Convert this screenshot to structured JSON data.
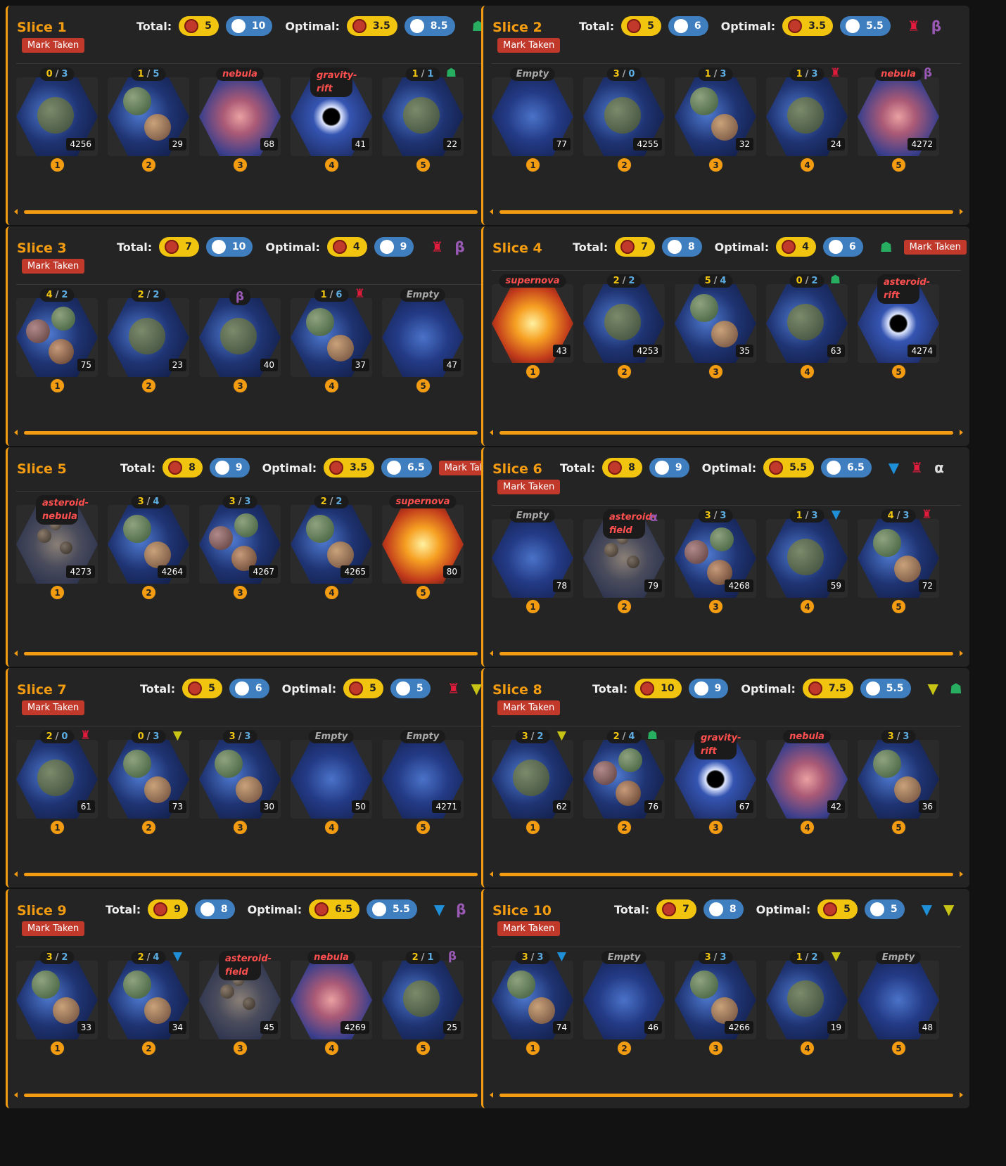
{
  "labels": {
    "total": "Total:",
    "optimal": "Optimal:",
    "mark_taken": "Mark Taken"
  },
  "icons": {
    "hacan": {
      "glyph": "☗",
      "name": "green-faction-icon"
    },
    "red": {
      "glyph": "♜",
      "name": "red-faction-icon"
    },
    "beta": {
      "glyph": "β",
      "name": "beta-wormhole-icon"
    },
    "alpha": {
      "glyph": "α",
      "name": "alpha-wormhole-icon"
    },
    "blue": {
      "glyph": "▼",
      "name": "blue-tech-skip-icon"
    },
    "yellow": {
      "glyph": "▼",
      "name": "yellow-tech-skip-icon"
    }
  },
  "slices": [
    {
      "name": "Slice 1",
      "mark_inline": false,
      "total": {
        "res": "5",
        "inf": "10"
      },
      "optimal": {
        "res": "3.5",
        "inf": "8.5"
      },
      "tags": [
        "hacan"
      ],
      "tiles": [
        {
          "label_type": "ratio",
          "r": "0",
          "i": "3",
          "icon": "",
          "id": "4256",
          "pos": "1",
          "bg": "planet1"
        },
        {
          "label_type": "ratio",
          "r": "1",
          "i": "5",
          "icon": "",
          "id": "29",
          "pos": "2",
          "bg": "planet2"
        },
        {
          "label_type": "text",
          "text": "nebula",
          "color": "red",
          "icon": "",
          "id": "68",
          "pos": "3",
          "bg": "nebula"
        },
        {
          "label_type": "text",
          "text": "gravity-rift",
          "color": "red",
          "two": true,
          "icon": "",
          "id": "41",
          "pos": "4",
          "bg": "rift"
        },
        {
          "label_type": "ratio",
          "r": "1",
          "i": "1",
          "icon": "hacan",
          "id": "22",
          "pos": "5",
          "bg": "planet1"
        }
      ]
    },
    {
      "name": "Slice 2",
      "mark_inline": false,
      "total": {
        "res": "5",
        "inf": "6"
      },
      "optimal": {
        "res": "3.5",
        "inf": "5.5"
      },
      "tags": [
        "red",
        "beta"
      ],
      "tiles": [
        {
          "label_type": "text",
          "text": "Empty",
          "color": "empty",
          "icon": "",
          "id": "77",
          "pos": "1",
          "bg": "empty"
        },
        {
          "label_type": "ratio",
          "r": "3",
          "i": "0",
          "icon": "",
          "id": "4255",
          "pos": "2",
          "bg": "planet1"
        },
        {
          "label_type": "ratio",
          "r": "1",
          "i": "3",
          "icon": "",
          "id": "32",
          "pos": "3",
          "bg": "planet2"
        },
        {
          "label_type": "ratio",
          "r": "1",
          "i": "3",
          "icon": "red",
          "id": "24",
          "pos": "4",
          "bg": "planet1"
        },
        {
          "label_type": "text",
          "text": "nebula",
          "color": "red",
          "icon": "beta",
          "id": "4272",
          "pos": "5",
          "bg": "nebula"
        }
      ]
    },
    {
      "name": "Slice 3",
      "mark_inline": false,
      "total": {
        "res": "7",
        "inf": "10"
      },
      "optimal": {
        "res": "4",
        "inf": "9"
      },
      "tags": [
        "red",
        "beta"
      ],
      "tiles": [
        {
          "label_type": "ratio",
          "r": "4",
          "i": "2",
          "icon": "",
          "id": "75",
          "pos": "1",
          "bg": "planet3"
        },
        {
          "label_type": "ratio",
          "r": "2",
          "i": "2",
          "icon": "",
          "id": "23",
          "pos": "2",
          "bg": "planet1"
        },
        {
          "label_type": "text",
          "text": "β",
          "color": "beta",
          "icon": "",
          "id": "40",
          "pos": "3",
          "bg": "planet1"
        },
        {
          "label_type": "ratio",
          "r": "1",
          "i": "6",
          "icon": "red",
          "id": "37",
          "pos": "4",
          "bg": "planet2"
        },
        {
          "label_type": "text",
          "text": "Empty",
          "color": "empty",
          "icon": "",
          "id": "47",
          "pos": "5",
          "bg": "empty"
        }
      ]
    },
    {
      "name": "Slice 4",
      "mark_inline": true,
      "total": {
        "res": "7",
        "inf": "8"
      },
      "optimal": {
        "res": "4",
        "inf": "6"
      },
      "tags": [
        "hacan"
      ],
      "tiles": [
        {
          "label_type": "text",
          "text": "supernova",
          "color": "red",
          "icon": "",
          "id": "43",
          "pos": "1",
          "bg": "supernova"
        },
        {
          "label_type": "ratio",
          "r": "2",
          "i": "2",
          "icon": "",
          "id": "4253",
          "pos": "2",
          "bg": "planet1"
        },
        {
          "label_type": "ratio",
          "r": "5",
          "i": "4",
          "icon": "",
          "id": "35",
          "pos": "3",
          "bg": "planet2"
        },
        {
          "label_type": "ratio",
          "r": "0",
          "i": "2",
          "icon": "hacan",
          "id": "63",
          "pos": "4",
          "bg": "planet1"
        },
        {
          "label_type": "text",
          "text": "asteroid-rift",
          "color": "red",
          "two": true,
          "icon": "",
          "id": "4274",
          "pos": "5",
          "bg": "rift"
        }
      ]
    },
    {
      "name": "Slice 5",
      "mark_inline": true,
      "total": {
        "res": "8",
        "inf": "9"
      },
      "optimal": {
        "res": "3.5",
        "inf": "6.5"
      },
      "tags": [],
      "tiles": [
        {
          "label_type": "text",
          "text": "asteroid-nebula",
          "color": "red",
          "two": true,
          "icon": "",
          "id": "4273",
          "pos": "1",
          "bg": "asteroid"
        },
        {
          "label_type": "ratio",
          "r": "3",
          "i": "4",
          "icon": "",
          "id": "4264",
          "pos": "2",
          "bg": "planet2"
        },
        {
          "label_type": "ratio",
          "r": "3",
          "i": "3",
          "icon": "",
          "id": "4267",
          "pos": "3",
          "bg": "planet3"
        },
        {
          "label_type": "ratio",
          "r": "2",
          "i": "2",
          "icon": "",
          "id": "4265",
          "pos": "4",
          "bg": "planet2"
        },
        {
          "label_type": "text",
          "text": "supernova",
          "color": "red",
          "icon": "",
          "id": "80",
          "pos": "5",
          "bg": "supernova"
        }
      ]
    },
    {
      "name": "Slice 6",
      "mark_inline": false,
      "total": {
        "res": "8",
        "inf": "9"
      },
      "optimal": {
        "res": "5.5",
        "inf": "6.5"
      },
      "tags": [
        "blue",
        "red",
        "alpha"
      ],
      "tiles": [
        {
          "label_type": "text",
          "text": "Empty",
          "color": "empty",
          "icon": "",
          "id": "78",
          "pos": "1",
          "bg": "empty"
        },
        {
          "label_type": "text",
          "text": "asteroid-field",
          "color": "red",
          "two": true,
          "icon": "alpha",
          "id": "79",
          "pos": "2",
          "bg": "asteroid"
        },
        {
          "label_type": "ratio",
          "r": "3",
          "i": "3",
          "icon": "",
          "id": "4268",
          "pos": "3",
          "bg": "planet3"
        },
        {
          "label_type": "ratio",
          "r": "1",
          "i": "3",
          "icon": "blue",
          "id": "59",
          "pos": "4",
          "bg": "planet1"
        },
        {
          "label_type": "ratio",
          "r": "4",
          "i": "3",
          "icon": "red",
          "id": "72",
          "pos": "5",
          "bg": "planet2"
        }
      ]
    },
    {
      "name": "Slice 7",
      "mark_inline": false,
      "total": {
        "res": "5",
        "inf": "6"
      },
      "optimal": {
        "res": "5",
        "inf": "5"
      },
      "tags": [
        "red",
        "yellow"
      ],
      "tiles": [
        {
          "label_type": "ratio",
          "r": "2",
          "i": "0",
          "icon": "red",
          "id": "61",
          "pos": "1",
          "bg": "planet1"
        },
        {
          "label_type": "ratio",
          "r": "0",
          "i": "3",
          "icon": "yellow",
          "id": "73",
          "pos": "2",
          "bg": "planet2"
        },
        {
          "label_type": "ratio",
          "r": "3",
          "i": "3",
          "icon": "",
          "id": "30",
          "pos": "3",
          "bg": "planet2"
        },
        {
          "label_type": "text",
          "text": "Empty",
          "color": "empty",
          "icon": "",
          "id": "50",
          "pos": "4",
          "bg": "empty"
        },
        {
          "label_type": "text",
          "text": "Empty",
          "color": "empty",
          "icon": "",
          "id": "4271",
          "pos": "5",
          "bg": "empty"
        }
      ]
    },
    {
      "name": "Slice 8",
      "mark_inline": false,
      "total": {
        "res": "10",
        "inf": "9"
      },
      "optimal": {
        "res": "7.5",
        "inf": "5.5"
      },
      "tags": [
        "yellow",
        "hacan"
      ],
      "tiles": [
        {
          "label_type": "ratio",
          "r": "3",
          "i": "2",
          "icon": "yellow",
          "id": "62",
          "pos": "1",
          "bg": "planet1"
        },
        {
          "label_type": "ratio",
          "r": "2",
          "i": "4",
          "icon": "hacan",
          "id": "76",
          "pos": "2",
          "bg": "planet3"
        },
        {
          "label_type": "text",
          "text": "gravity-rift",
          "color": "red",
          "two": true,
          "icon": "",
          "id": "67",
          "pos": "3",
          "bg": "rift"
        },
        {
          "label_type": "text",
          "text": "nebula",
          "color": "red",
          "icon": "",
          "id": "42",
          "pos": "4",
          "bg": "nebula"
        },
        {
          "label_type": "ratio",
          "r": "3",
          "i": "3",
          "icon": "",
          "id": "36",
          "pos": "5",
          "bg": "planet2"
        }
      ]
    },
    {
      "name": "Slice 9",
      "mark_inline": false,
      "total": {
        "res": "9",
        "inf": "8"
      },
      "optimal": {
        "res": "6.5",
        "inf": "5.5"
      },
      "tags": [
        "blue",
        "beta"
      ],
      "tiles": [
        {
          "label_type": "ratio",
          "r": "3",
          "i": "2",
          "icon": "",
          "id": "33",
          "pos": "1",
          "bg": "planet2"
        },
        {
          "label_type": "ratio",
          "r": "2",
          "i": "4",
          "icon": "blue",
          "id": "34",
          "pos": "2",
          "bg": "planet2"
        },
        {
          "label_type": "text",
          "text": "asteroid-field",
          "color": "red",
          "two": true,
          "icon": "",
          "id": "45",
          "pos": "3",
          "bg": "asteroid"
        },
        {
          "label_type": "text",
          "text": "nebula",
          "color": "red",
          "icon": "",
          "id": "4269",
          "pos": "4",
          "bg": "nebula"
        },
        {
          "label_type": "ratio",
          "r": "2",
          "i": "1",
          "icon": "beta",
          "id": "25",
          "pos": "5",
          "bg": "planet1"
        }
      ]
    },
    {
      "name": "Slice 10",
      "mark_inline": false,
      "total": {
        "res": "7",
        "inf": "8"
      },
      "optimal": {
        "res": "5",
        "inf": "5"
      },
      "tags": [
        "blue",
        "yellow"
      ],
      "tiles": [
        {
          "label_type": "ratio",
          "r": "3",
          "i": "3",
          "icon": "blue",
          "id": "74",
          "pos": "1",
          "bg": "planet2"
        },
        {
          "label_type": "text",
          "text": "Empty",
          "color": "empty",
          "icon": "",
          "id": "46",
          "pos": "2",
          "bg": "empty"
        },
        {
          "label_type": "ratio",
          "r": "3",
          "i": "3",
          "icon": "",
          "id": "4266",
          "pos": "3",
          "bg": "planet2"
        },
        {
          "label_type": "ratio",
          "r": "1",
          "i": "2",
          "icon": "yellow",
          "id": "19",
          "pos": "4",
          "bg": "planet1"
        },
        {
          "label_type": "text",
          "text": "Empty",
          "color": "empty",
          "icon": "",
          "id": "48",
          "pos": "5",
          "bg": "empty"
        }
      ]
    }
  ]
}
